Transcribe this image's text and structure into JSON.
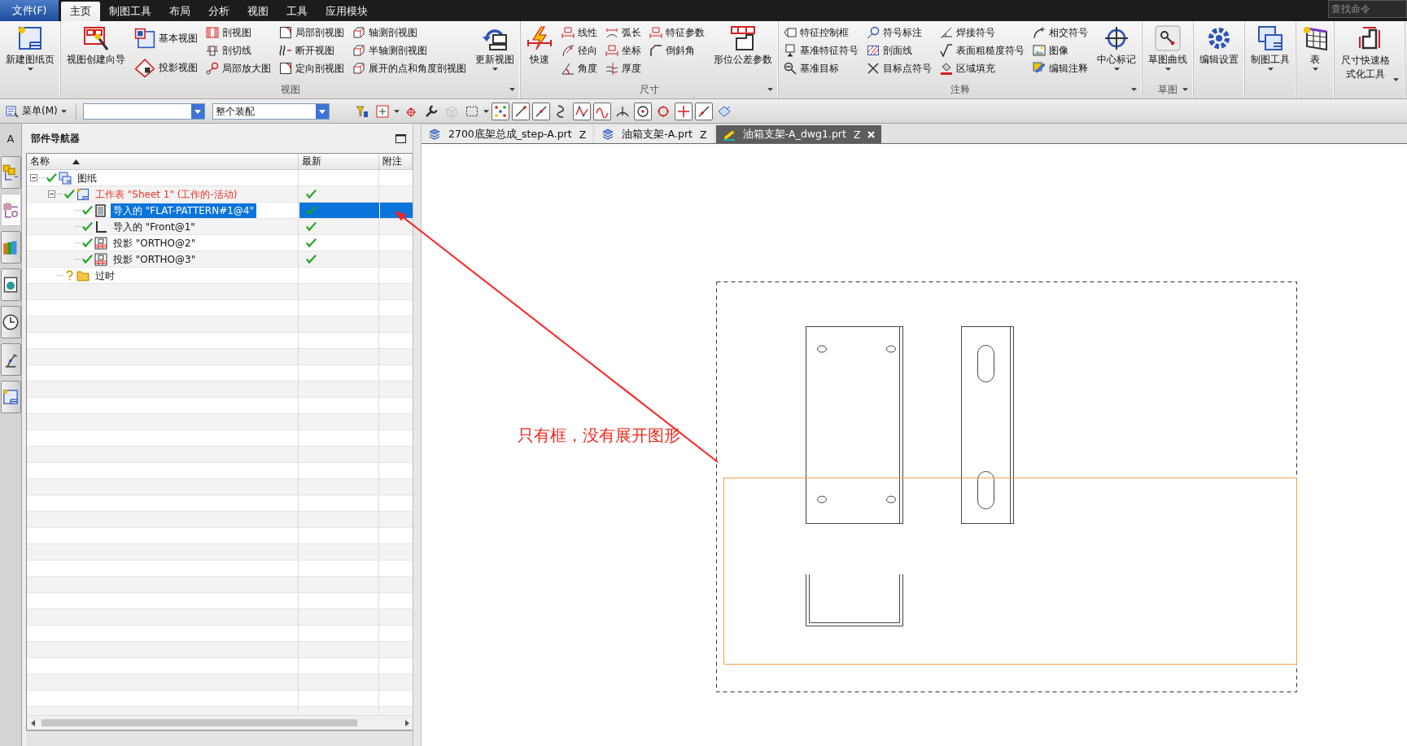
{
  "menu_bar": {
    "file_menu": "文件(F)",
    "tabs": [
      {
        "label": "主页",
        "selected": true
      },
      {
        "label": "制图工具",
        "selected": false
      },
      {
        "label": "布局",
        "selected": false
      },
      {
        "label": "分析",
        "selected": false
      },
      {
        "label": "视图",
        "selected": false
      },
      {
        "label": "工具",
        "selected": false
      },
      {
        "label": "应用模块",
        "selected": false
      }
    ],
    "search": {
      "placeholder": "查找命令"
    }
  },
  "ribbon": {
    "groups": [
      {
        "items": [
          {
            "kind": "large",
            "label": "新建图纸页",
            "dropdown": true
          }
        ]
      },
      {
        "title": "视图",
        "launcher": true,
        "items": [
          {
            "kind": "large",
            "label": "视图创建向导",
            "dropdown": false
          },
          {
            "kind": "stack",
            "buttons": [
              {
                "label": "基本视图"
              },
              {
                "label": "投影视图"
              }
            ]
          },
          {
            "kind": "column",
            "buttons": [
              {
                "label": "剖视图"
              },
              {
                "label": "剖切线"
              },
              {
                "label": "局部放大图"
              }
            ]
          },
          {
            "kind": "column",
            "buttons": [
              {
                "label": "局部剖视图"
              },
              {
                "label": "断开视图"
              },
              {
                "label": "定向剖视图"
              }
            ]
          },
          {
            "kind": "column",
            "buttons": [
              {
                "label": "轴测剖视图"
              },
              {
                "label": "半轴测剖视图"
              },
              {
                "label": "展开的点和角度剖视图"
              }
            ]
          },
          {
            "kind": "large",
            "label": "更新视图",
            "dropdown": true
          }
        ]
      },
      {
        "title": "尺寸",
        "launcher": true,
        "items": [
          {
            "kind": "large",
            "label": "快速",
            "dropdown": false
          },
          {
            "kind": "column",
            "buttons": [
              {
                "label": "线性"
              },
              {
                "label": "径向"
              },
              {
                "label": "角度"
              }
            ]
          },
          {
            "kind": "column",
            "buttons": [
              {
                "label": "弧长"
              },
              {
                "label": "坐标"
              },
              {
                "label": "厚度"
              }
            ]
          },
          {
            "kind": "column",
            "buttons": [
              {
                "label": "特征参数"
              },
              {
                "label": "倒斜角"
              }
            ]
          },
          {
            "kind": "large",
            "label": "形位公差参数",
            "dropdown": false
          }
        ]
      },
      {
        "title": "注释",
        "launcher": true,
        "items": [
          {
            "kind": "column",
            "buttons": [
              {
                "label": "特征控制框"
              },
              {
                "label": "基准特征符号"
              },
              {
                "label": "基准目标"
              }
            ]
          },
          {
            "kind": "column",
            "buttons": [
              {
                "label": "符号标注"
              },
              {
                "label": "剖面线"
              },
              {
                "label": "目标点符号"
              }
            ]
          },
          {
            "kind": "column",
            "buttons": [
              {
                "label": "焊接符号"
              },
              {
                "label": "表面粗糙度符号"
              },
              {
                "label": "区域填充"
              }
            ]
          },
          {
            "kind": "column",
            "buttons": [
              {
                "label": "相交符号"
              },
              {
                "label": "图像"
              },
              {
                "label": "编辑注释"
              }
            ]
          },
          {
            "kind": "large",
            "label": "中心标记",
            "dropdown": true
          }
        ]
      },
      {
        "title": "草图",
        "launcher": true,
        "items": [
          {
            "kind": "large",
            "label": "草图曲线",
            "dropdown": true
          }
        ]
      },
      {
        "items": [
          {
            "kind": "large",
            "label": "编辑设置",
            "dropdown": false
          }
        ]
      },
      {
        "items": [
          {
            "kind": "large",
            "label": "制图工具",
            "dropdown": true
          }
        ]
      },
      {
        "items": [
          {
            "kind": "large",
            "label": "表",
            "dropdown": true
          }
        ]
      },
      {
        "items": [
          {
            "kind": "wrapped",
            "label": "尺寸快速格式化工具",
            "dropdown": true
          }
        ]
      }
    ]
  },
  "toolbar": {
    "menu_button": "菜单(M)",
    "combos": [
      {
        "disabled": false
      },
      {
        "value": "整个装配",
        "disabled": false
      }
    ],
    "tools": [
      {
        "on": false,
        "dropdown": false,
        "disabled": false
      },
      {
        "on": false,
        "dropdown": true,
        "disabled": false
      },
      {
        "on": false,
        "dropdown": false,
        "disabled": false
      },
      {
        "on": false,
        "dropdown": false,
        "disabled": false
      },
      {
        "on": false,
        "dropdown": false,
        "disabled": true
      },
      {
        "on": false,
        "dropdown": true,
        "disabled": false
      },
      {
        "on": true,
        "dropdown": false,
        "disabled": false
      },
      {
        "on": true,
        "dropdown": false,
        "disabled": false
      },
      {
        "on": true,
        "dropdown": false,
        "disabled": false
      },
      {
        "on": false,
        "dropdown": false,
        "disabled": false
      },
      {
        "on": true,
        "dropdown": false,
        "disabled": false
      },
      {
        "on": true,
        "dropdown": false,
        "disabled": false
      },
      {
        "on": false,
        "dropdown": false,
        "disabled": false
      },
      {
        "on": true,
        "dropdown": false,
        "disabled": false
      },
      {
        "on": false,
        "dropdown": false,
        "disabled": false
      },
      {
        "on": true,
        "dropdown": false,
        "disabled": false
      },
      {
        "on": true,
        "dropdown": false,
        "disabled": false
      },
      {
        "on": false,
        "dropdown": false,
        "disabled": false
      }
    ]
  },
  "left_bar": {
    "label": "A",
    "tabs": [
      {
        "selected": false
      },
      {
        "selected": true
      },
      {
        "selected": false
      },
      {
        "selected": false
      },
      {
        "selected": false
      },
      {
        "selected": false
      },
      {
        "selected": false
      }
    ]
  },
  "navigator": {
    "title": "部件导航器",
    "columns": [
      {
        "label": "名称",
        "sorted": true
      },
      {
        "label": "最新",
        "sorted": false
      },
      {
        "label": "附注",
        "sorted": false
      }
    ],
    "tree": [
      {
        "label": "图纸",
        "kind": "drawing",
        "checked": true,
        "uncertain": false,
        "latest": false,
        "active": false,
        "selected": false,
        "expanded": true,
        "children": [
          {
            "label": "工作表 \"Sheet 1\" (工作的-活动)",
            "kind": "sheet",
            "checked": true,
            "uncertain": false,
            "latest": true,
            "active": true,
            "selected": false,
            "expanded": true,
            "children": [
              {
                "label": "导入的 \"FLAT-PATTERN#1@4\"",
                "kind": "flat",
                "checked": true,
                "uncertain": false,
                "latest": true,
                "active": false,
                "selected": true
              },
              {
                "label": "导入的 \"Front@1\"",
                "kind": "front",
                "checked": true,
                "uncertain": false,
                "latest": true,
                "active": false,
                "selected": false
              },
              {
                "label": "投影 \"ORTHO@2\"",
                "kind": "projection",
                "checked": true,
                "uncertain": false,
                "latest": true,
                "active": false,
                "selected": false
              },
              {
                "label": "投影 \"ORTHO@3\"",
                "kind": "projection",
                "checked": true,
                "uncertain": false,
                "latest": true,
                "active": false,
                "selected": false
              }
            ]
          },
          {
            "label": "过时",
            "kind": "folder",
            "checked": false,
            "uncertain": true,
            "latest": false,
            "active": false,
            "selected": false
          }
        ]
      }
    ]
  },
  "documents": [
    {
      "label": "2700底架总成_step-A.prt",
      "flag": "Z",
      "kind": "part",
      "selected": false
    },
    {
      "label": "油箱支架-A.prt",
      "flag": "Z",
      "kind": "part",
      "selected": false
    },
    {
      "label": "油箱支架-A_dwg1.prt",
      "flag": "Z",
      "kind": "drawing",
      "selected": true
    }
  ],
  "annotation": {
    "text": "只有框，没有展开图形"
  }
}
